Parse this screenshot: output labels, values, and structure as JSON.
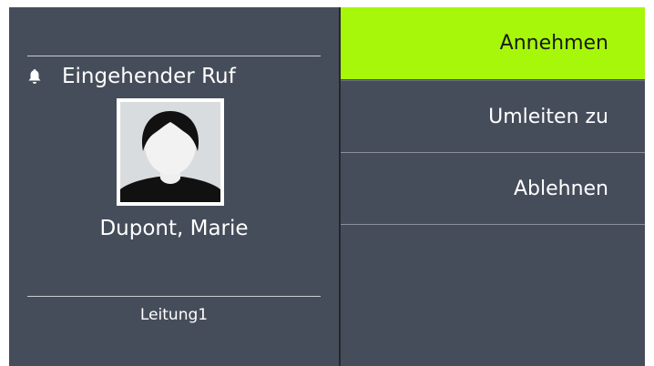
{
  "call": {
    "title": "Eingehender Ruf",
    "title_icon": "bell-icon",
    "caller_name": "Dupont, Marie",
    "line": "Leitung1",
    "avatar_icon": "person-avatar-icon"
  },
  "menu": {
    "items": [
      {
        "label": "Annehmen",
        "active": true
      },
      {
        "label": "Umleiten zu",
        "active": false
      },
      {
        "label": "Ablehnen",
        "active": false
      }
    ]
  },
  "colors": {
    "background": "#464d5a",
    "accent": "#a6f70a",
    "text": "#ffffff"
  }
}
